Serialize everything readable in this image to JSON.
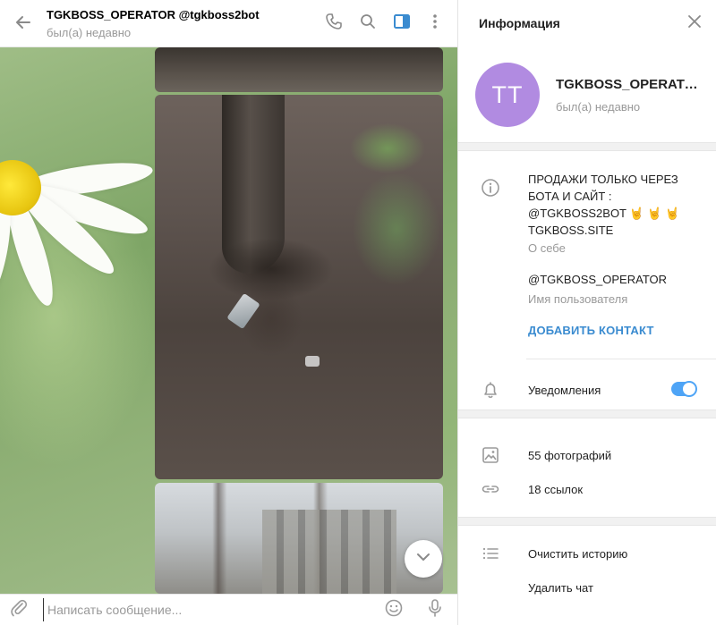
{
  "chat": {
    "title": "TGKBOSS_OPERATOR @tgkboss2bot",
    "status": "был(а) недавно",
    "composer_placeholder": "Написать сообщение..."
  },
  "info": {
    "header": "Информация",
    "avatar_initials": "TT",
    "name": "TGKBOSS_OPERATOR",
    "status": "был(а) недавно",
    "bio_lines": [
      "ПРОДАЖИ ТОЛЬКО ЧЕРЕЗ",
      "БОТА И САЙТ :",
      "@TGKBOSS2BOT 🤘 🤘 🤘",
      "TGKBOSS.SITE"
    ],
    "bio_label": "О себе",
    "username": "@TGKBOSS_OPERATOR",
    "username_label": "Имя пользователя",
    "add_contact": "ДОБАВИТЬ КОНТАКТ",
    "notifications_label": "Уведомления",
    "notifications_on": true,
    "photos": "55 фотографий",
    "links": "18 ссылок",
    "clear_history": "Очистить историю",
    "delete_chat": "Удалить чат"
  },
  "icons": {
    "back": "arrow-left-icon",
    "call": "phone-icon",
    "search": "search-icon",
    "sidebar": "sidebar-toggle-icon",
    "more": "more-vertical-icon",
    "close": "close-icon",
    "info": "info-icon",
    "bell": "bell-icon",
    "photo": "photo-icon",
    "link": "link-icon",
    "list": "list-icon",
    "attach": "paperclip-icon",
    "emoji": "emoji-icon",
    "mic": "microphone-icon",
    "scroll_down": "chevron-down-icon"
  },
  "colors": {
    "accent": "#3a8bd0",
    "toggle": "#4ea4f6",
    "avatar": "#b18be1",
    "muted": "#999999"
  }
}
